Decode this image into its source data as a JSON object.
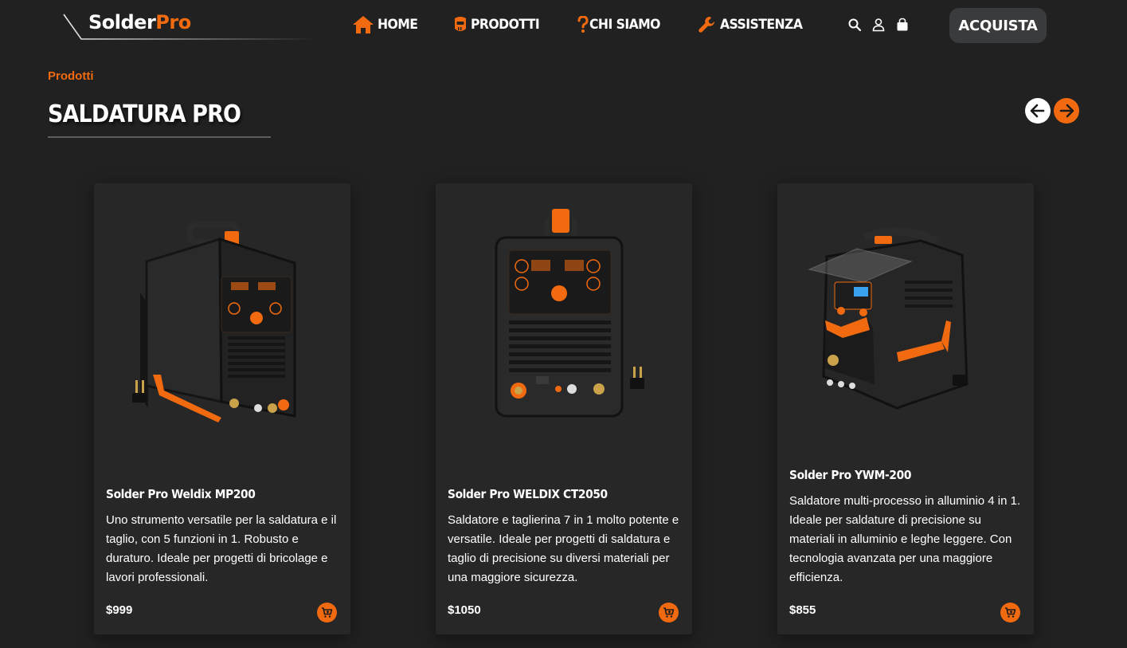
{
  "brand": {
    "name_main": "Solder",
    "name_accent": "Pro"
  },
  "nav": {
    "items": [
      {
        "label": "HOME",
        "icon": "home-icon"
      },
      {
        "label": "PRODOTTI",
        "icon": "welding-mask-icon"
      },
      {
        "label": "CHI SIAMO",
        "icon": "question-mark-icon"
      },
      {
        "label": "ASSISTENZA",
        "icon": "wrench-icon"
      }
    ]
  },
  "utils": {
    "search": "search-icon",
    "account": "user-icon",
    "cart": "shopping-bag-icon"
  },
  "buy_button": "ACQUISTA",
  "section": {
    "breadcrumb": "Prodotti",
    "title": "SALDATURA PRO"
  },
  "products": [
    {
      "name": "Solder Pro Weldix MP200",
      "description": "Uno strumento versatile per la saldatura e il taglio, con 5 funzioni in 1. Robusto e duraturo. Ideale per progetti di bricolage e lavori professionali.",
      "price": "$999"
    },
    {
      "name": "Solder Pro WELDIX CT2050",
      "description": "Saldatore e taglierina 7 in 1 molto potente e versatile. Ideale per progetti di saldatura e taglio di precisione su diversi materiali per una maggiore sicurezza.",
      "price": "$1050"
    },
    {
      "name": "Solder Pro YWM-200",
      "description": "Saldatore multi-processo in alluminio 4 in 1. Ideale per saldature di precisione su materiali in alluminio e leghe leggere. Con tecnologia avanzata per una maggiore efficienza.",
      "price": "$855"
    }
  ],
  "colors": {
    "accent": "#f26a10",
    "background": "#212121",
    "card": "#272727",
    "button": "#3a3b3d"
  }
}
